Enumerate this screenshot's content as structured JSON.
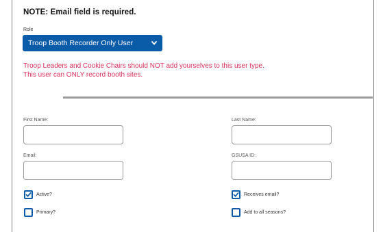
{
  "note": "NOTE: Email field is required.",
  "role": {
    "label": "Role",
    "selected": "Troop Booth Recorder Only User",
    "chevron_icon": "chevron-down-icon",
    "bg_color": "#0b5ca8"
  },
  "warning": {
    "line1": "Troop Leaders and Cookie Chairs should NOT add yourselves to this user type.",
    "line2": "This user can ONLY record booth sites.",
    "color": "#d8315b"
  },
  "form": {
    "first_name": {
      "label": "First Name:",
      "value": ""
    },
    "last_name": {
      "label": "Last Name:",
      "value": ""
    },
    "email": {
      "label": "Email:",
      "value": ""
    },
    "gsusa_id": {
      "label": "GSUSA ID:",
      "value": ""
    }
  },
  "checkboxes": {
    "active": {
      "label": "Active?",
      "checked": true
    },
    "receives_email": {
      "label": "Receives email?",
      "checked": true
    },
    "primary": {
      "label": "Primary?",
      "checked": false
    },
    "add_to_all_seasons": {
      "label": "Add to all seasons?",
      "checked": false
    }
  }
}
